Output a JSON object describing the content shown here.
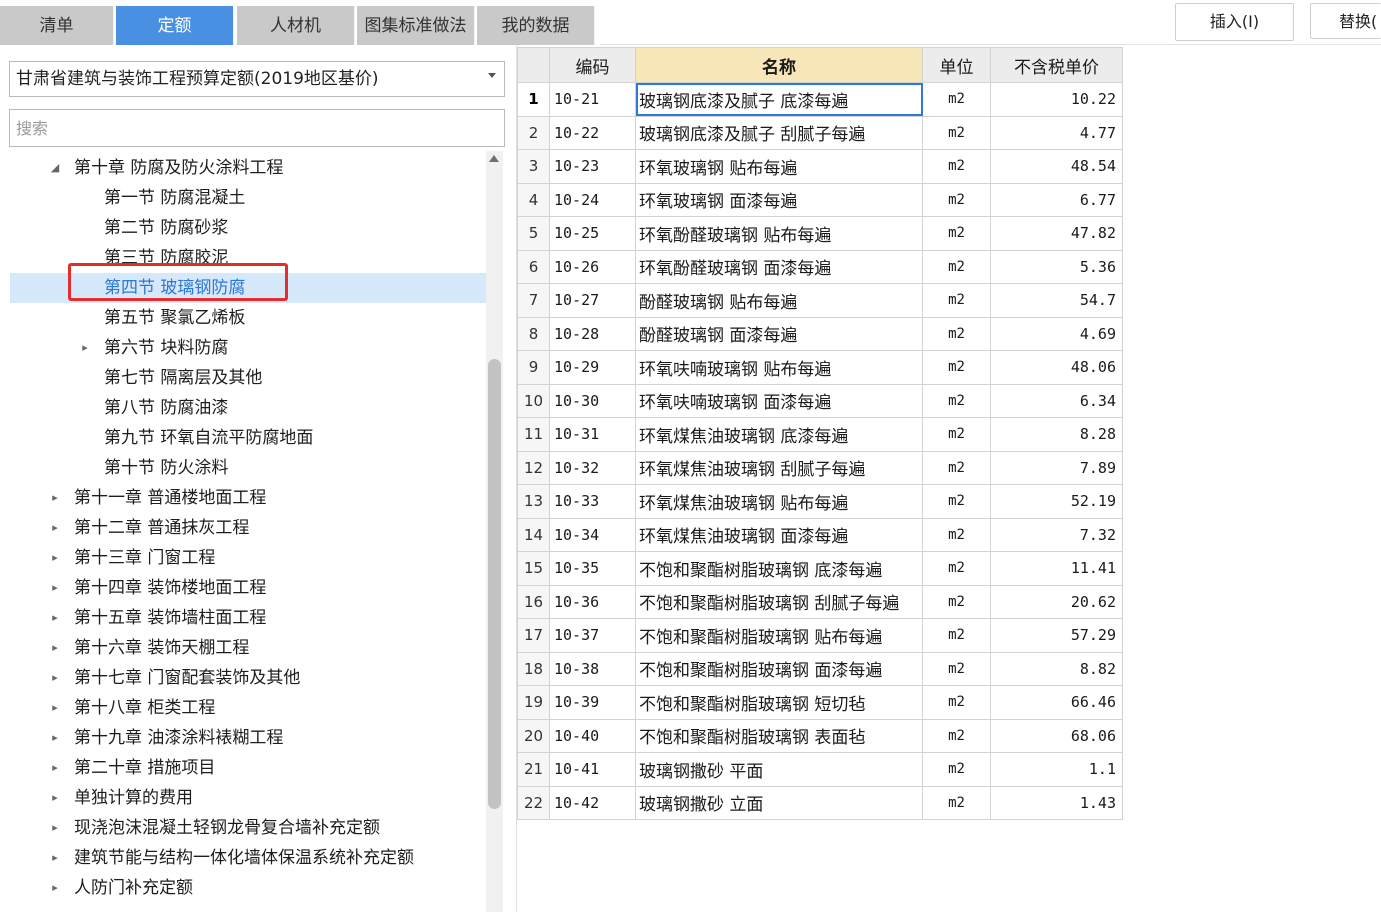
{
  "tabs": [
    {
      "label": "清单",
      "active": false
    },
    {
      "label": "定额",
      "active": true
    },
    {
      "label": "人材机",
      "active": false
    },
    {
      "label": "图集标准做法",
      "active": false
    },
    {
      "label": "我的数据",
      "active": false
    }
  ],
  "toolbar": {
    "insert_label": "插入(I)",
    "replace_label": "替换("
  },
  "library_select": {
    "value": "甘肃省建筑与装饰工程预算定额(2019地区基价)"
  },
  "search": {
    "placeholder": "搜索"
  },
  "tree": [
    {
      "label": "第十章 防腐及防火涂料工程",
      "level": 0,
      "twisty": "expanded"
    },
    {
      "label": "第一节 防腐混凝土",
      "level": 1,
      "twisty": "none"
    },
    {
      "label": "第二节 防腐砂浆",
      "level": 1,
      "twisty": "none"
    },
    {
      "label": "第三节 防腐胶泥",
      "level": 1,
      "twisty": "none"
    },
    {
      "label": "第四节 玻璃钢防腐",
      "level": 1,
      "twisty": "none",
      "selected": true
    },
    {
      "label": "第五节 聚氯乙烯板",
      "level": 1,
      "twisty": "none"
    },
    {
      "label": "第六节 块料防腐",
      "level": 1,
      "twisty": "collapsed"
    },
    {
      "label": "第七节 隔离层及其他",
      "level": 1,
      "twisty": "none"
    },
    {
      "label": "第八节 防腐油漆",
      "level": 1,
      "twisty": "none"
    },
    {
      "label": "第九节 环氧自流平防腐地面",
      "level": 1,
      "twisty": "none"
    },
    {
      "label": "第十节 防火涂料",
      "level": 1,
      "twisty": "none"
    },
    {
      "label": "第十一章 普通楼地面工程",
      "level": 0,
      "twisty": "collapsed"
    },
    {
      "label": "第十二章 普通抹灰工程",
      "level": 0,
      "twisty": "collapsed"
    },
    {
      "label": "第十三章 门窗工程",
      "level": 0,
      "twisty": "collapsed"
    },
    {
      "label": "第十四章 装饰楼地面工程",
      "level": 0,
      "twisty": "collapsed"
    },
    {
      "label": "第十五章 装饰墙柱面工程",
      "level": 0,
      "twisty": "collapsed"
    },
    {
      "label": "第十六章 装饰天棚工程",
      "level": 0,
      "twisty": "collapsed"
    },
    {
      "label": "第十七章 门窗配套装饰及其他",
      "level": 0,
      "twisty": "collapsed"
    },
    {
      "label": "第十八章 柜类工程",
      "level": 0,
      "twisty": "collapsed"
    },
    {
      "label": "第十九章 油漆涂料裱糊工程",
      "level": 0,
      "twisty": "collapsed"
    },
    {
      "label": "第二十章 措施项目",
      "level": 0,
      "twisty": "collapsed"
    },
    {
      "label": "单独计算的费用",
      "level": 0,
      "twisty": "collapsed"
    },
    {
      "label": "现浇泡沫混凝土轻钢龙骨复合墙补充定额",
      "level": 0,
      "twisty": "collapsed"
    },
    {
      "label": "建筑节能与结构一体化墙体保温系统补充定额",
      "level": 0,
      "twisty": "collapsed"
    },
    {
      "label": "人防门补充定额",
      "level": 0,
      "twisty": "collapsed"
    }
  ],
  "table": {
    "headers": {
      "code": "编码",
      "name": "名称",
      "unit": "单位",
      "price": "不含税单价"
    },
    "rows": [
      {
        "no": "1",
        "code": "10-21",
        "name": "玻璃钢底漆及腻子 底漆每遍",
        "unit": "m2",
        "price": "10.22"
      },
      {
        "no": "2",
        "code": "10-22",
        "name": "玻璃钢底漆及腻子 刮腻子每遍",
        "unit": "m2",
        "price": "4.77"
      },
      {
        "no": "3",
        "code": "10-23",
        "name": "环氧玻璃钢 贴布每遍",
        "unit": "m2",
        "price": "48.54"
      },
      {
        "no": "4",
        "code": "10-24",
        "name": "环氧玻璃钢 面漆每遍",
        "unit": "m2",
        "price": "6.77"
      },
      {
        "no": "5",
        "code": "10-25",
        "name": "环氧酚醛玻璃钢 贴布每遍",
        "unit": "m2",
        "price": "47.82"
      },
      {
        "no": "6",
        "code": "10-26",
        "name": "环氧酚醛玻璃钢 面漆每遍",
        "unit": "m2",
        "price": "5.36"
      },
      {
        "no": "7",
        "code": "10-27",
        "name": "酚醛玻璃钢 贴布每遍",
        "unit": "m2",
        "price": "54.7"
      },
      {
        "no": "8",
        "code": "10-28",
        "name": "酚醛玻璃钢 面漆每遍",
        "unit": "m2",
        "price": "4.69"
      },
      {
        "no": "9",
        "code": "10-29",
        "name": "环氧呋喃玻璃钢 贴布每遍",
        "unit": "m2",
        "price": "48.06"
      },
      {
        "no": "10",
        "code": "10-30",
        "name": "环氧呋喃玻璃钢 面漆每遍",
        "unit": "m2",
        "price": "6.34"
      },
      {
        "no": "11",
        "code": "10-31",
        "name": "环氧煤焦油玻璃钢 底漆每遍",
        "unit": "m2",
        "price": "8.28"
      },
      {
        "no": "12",
        "code": "10-32",
        "name": "环氧煤焦油玻璃钢 刮腻子每遍",
        "unit": "m2",
        "price": "7.89"
      },
      {
        "no": "13",
        "code": "10-33",
        "name": "环氧煤焦油玻璃钢 贴布每遍",
        "unit": "m2",
        "price": "52.19"
      },
      {
        "no": "14",
        "code": "10-34",
        "name": "环氧煤焦油玻璃钢 面漆每遍",
        "unit": "m2",
        "price": "7.32"
      },
      {
        "no": "15",
        "code": "10-35",
        "name": "不饱和聚酯树脂玻璃钢 底漆每遍",
        "unit": "m2",
        "price": "11.41"
      },
      {
        "no": "16",
        "code": "10-36",
        "name": "不饱和聚酯树脂玻璃钢 刮腻子每遍",
        "unit": "m2",
        "price": "20.62"
      },
      {
        "no": "17",
        "code": "10-37",
        "name": "不饱和聚酯树脂玻璃钢 贴布每遍",
        "unit": "m2",
        "price": "57.29"
      },
      {
        "no": "18",
        "code": "10-38",
        "name": "不饱和聚酯树脂玻璃钢 面漆每遍",
        "unit": "m2",
        "price": "8.82"
      },
      {
        "no": "19",
        "code": "10-39",
        "name": "不饱和聚酯树脂玻璃钢 短切毡",
        "unit": "m2",
        "price": "66.46"
      },
      {
        "no": "20",
        "code": "10-40",
        "name": "不饱和聚酯树脂玻璃钢 表面毡",
        "unit": "m2",
        "price": "68.06"
      },
      {
        "no": "21",
        "code": "10-41",
        "name": "玻璃钢撒砂 平面",
        "unit": "m2",
        "price": "1.1"
      },
      {
        "no": "22",
        "code": "10-42",
        "name": "玻璃钢撒砂 立面",
        "unit": "m2",
        "price": "1.43"
      }
    ]
  },
  "colors": {
    "accent": "#4a90e2",
    "highlight": "#e42d2d",
    "selection": "#d6e8fb"
  }
}
